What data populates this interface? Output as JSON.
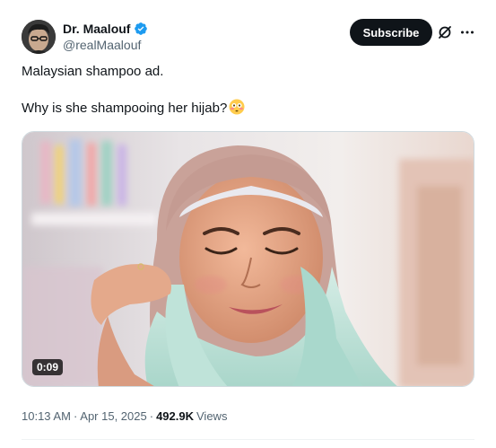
{
  "author": {
    "display_name": "Dr. Maalouf",
    "handle": "@realMaalouf",
    "verified": true,
    "verified_color": "#1d9bf0",
    "avatar_icon": "avatar-photo"
  },
  "actions": {
    "subscribe_label": "Subscribe",
    "grok_icon": "grok-icon",
    "more_icon": "more-icon"
  },
  "tweet": {
    "line1": "Malaysian shampoo ad.",
    "line2": "Why is she shampooing her hijab?",
    "emoji": "flushed-face-emoji"
  },
  "media": {
    "type": "video",
    "duration": "0:09"
  },
  "meta": {
    "time": "10:13 AM",
    "separator": "·",
    "date": "Apr 15, 2025",
    "views_count": "492.9K",
    "views_label": "Views"
  },
  "colors": {
    "text_primary": "#0f1419",
    "text_secondary": "#536471",
    "subscribe_bg": "#0f1419",
    "border": "#cfd9de"
  }
}
